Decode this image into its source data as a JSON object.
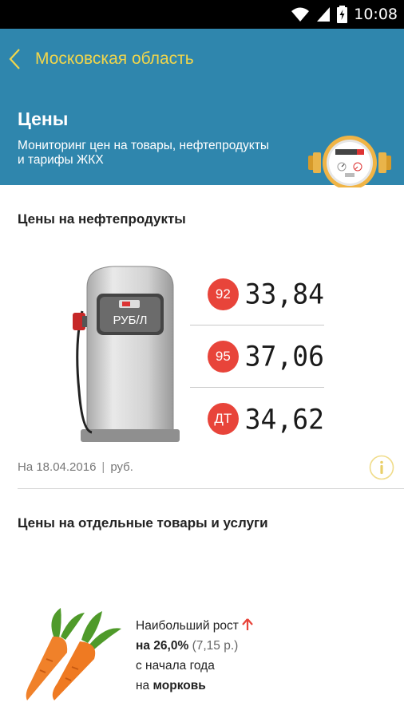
{
  "status_bar": {
    "time": "10:08",
    "icons": [
      "wifi-icon",
      "signal-icon",
      "battery-icon"
    ]
  },
  "header": {
    "region": "Московская область",
    "title": "Цены",
    "subtitle": "Мониторинг цен на товары, нефтепродукты и тарифы ЖКХ",
    "accent_color": "#2f86ad",
    "region_color": "#f2d64b"
  },
  "fuel": {
    "section_title": "Цены на нефтепродукты",
    "pump_label": "РУБ/Л",
    "items": [
      {
        "grade": "92",
        "price": "33,84"
      },
      {
        "grade": "95",
        "price": "37,06"
      },
      {
        "grade": "ДТ",
        "price": "34,62"
      }
    ],
    "badge_color": "#e8443a",
    "date": "На 18.04.2016",
    "separator": "|",
    "unit": "руб."
  },
  "goods": {
    "section_title": "Цены на отдельные товары и услуги",
    "growth_label": "Наибольший рост",
    "growth_value": "на 26,0%",
    "growth_amount": "(7,15 р.)",
    "growth_period": "с начала года",
    "product_prefix": "на",
    "product": "морковь",
    "arrow_color": "#e8443a"
  }
}
